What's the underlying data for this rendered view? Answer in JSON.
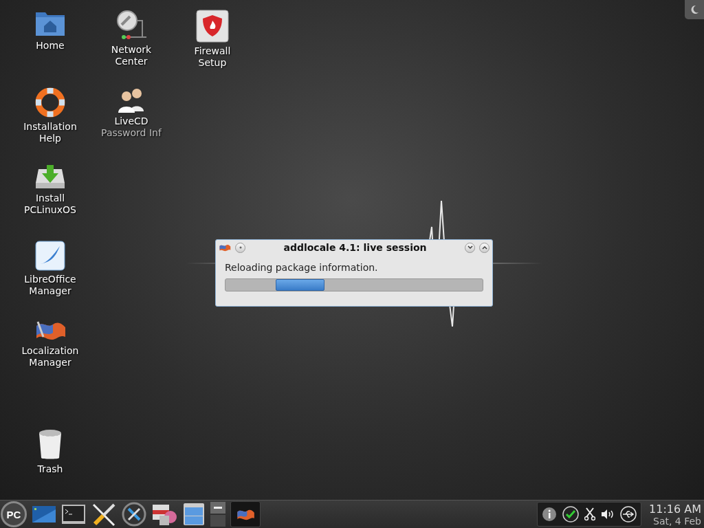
{
  "desktop": {
    "columns": [
      [
        {
          "kind": "home",
          "label": [
            "Home"
          ]
        },
        {
          "kind": "lifebuoy",
          "label": [
            "Installation",
            "Help"
          ]
        },
        {
          "kind": "install",
          "label": [
            "Install",
            "PCLinuxOS"
          ]
        },
        {
          "kind": "office",
          "label": [
            "LibreOffice",
            "Manager"
          ]
        },
        {
          "kind": "locale",
          "label": [
            "Localization",
            "Manager"
          ]
        },
        {
          "kind": "trash",
          "label": [
            "Trash"
          ]
        }
      ],
      [
        {
          "kind": "network",
          "label": [
            "Network",
            "Center"
          ]
        },
        {
          "kind": "users",
          "label": [
            "LiveCD",
            "Password Inf"
          ]
        }
      ],
      [
        {
          "kind": "firewall",
          "label": [
            "Firewall",
            "Setup"
          ]
        }
      ]
    ]
  },
  "dialog": {
    "title": "addlocale 4.1: live session",
    "message": "Reloading package information.",
    "level": 0.19
  },
  "taskbar": {
    "logo": "PC",
    "launchers": [
      {
        "kind": "desktop"
      },
      {
        "kind": "terminal"
      },
      {
        "kind": "tools"
      },
      {
        "kind": "settings"
      },
      {
        "kind": "package"
      },
      {
        "kind": "files"
      }
    ],
    "pager": [
      {
        "selected": true
      },
      {
        "selected": false
      }
    ],
    "tasks": [
      {
        "kind": "locale",
        "selected": true
      }
    ],
    "tray": [
      {
        "kind": "info"
      },
      {
        "kind": "check"
      },
      {
        "kind": "scissors"
      },
      {
        "kind": "volume"
      },
      {
        "kind": "usb"
      }
    ],
    "time": "11:16 AM",
    "date": "Sat, 4 Feb"
  }
}
